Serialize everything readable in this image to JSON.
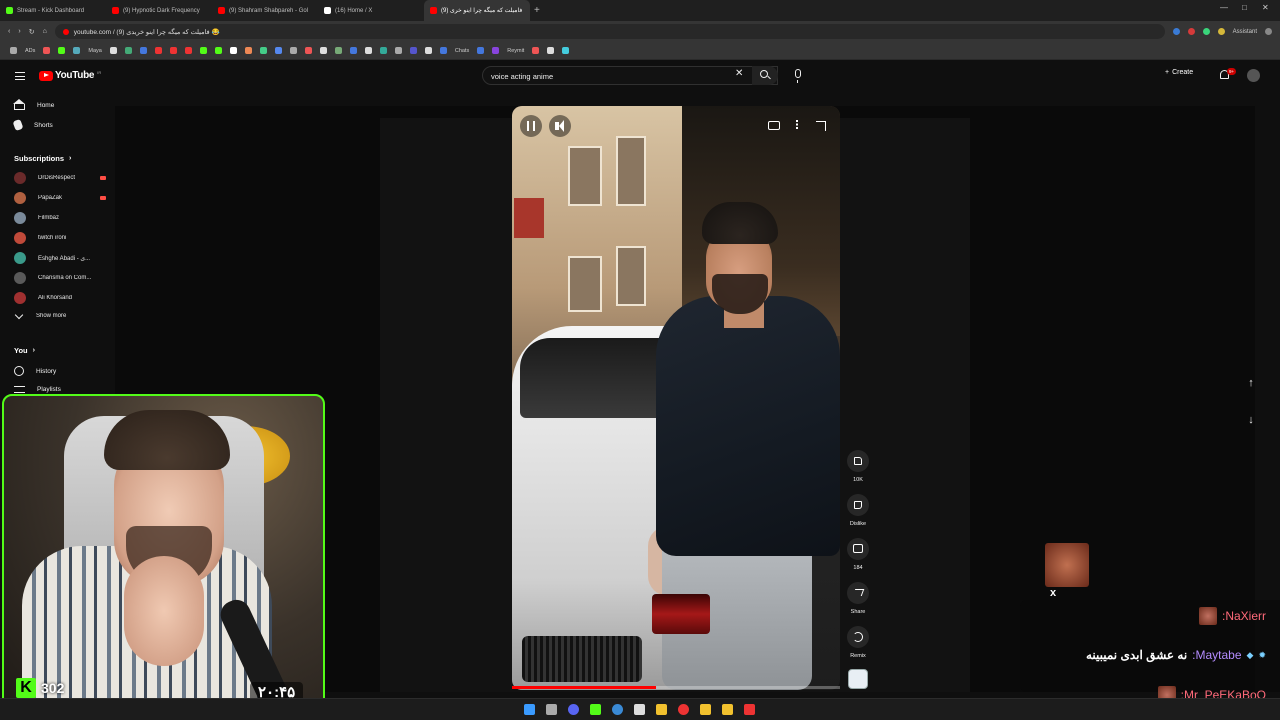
{
  "browser": {
    "tabs": [
      {
        "title": "Stream - Kick Dashboard",
        "favicon_color": "#53fc18",
        "active": false
      },
      {
        "title": "(9) Hypnotic Dark Frequency",
        "favicon_color": "#ff0000",
        "active": false
      },
      {
        "title": "(9) Shahram Shabpareh - Gol",
        "favicon_color": "#ff0000",
        "active": false
      },
      {
        "title": "(16) Home / X",
        "favicon_color": "#ffffff",
        "active": false
      },
      {
        "title": "(9) فامیلت که میگه چرا اینو خری",
        "favicon_color": "#ff0000",
        "active": true
      }
    ],
    "new_tab": "+",
    "address": "youtube.com / (9) فامیلت که میگه چرا اینو خریدی 😂",
    "assistant_label": "Assistant",
    "bookmarks": [
      "ADs",
      "Maya",
      "Chats",
      "Reymit"
    ]
  },
  "header": {
    "logo_text": "YouTube",
    "country_code": "IR",
    "search_value": "voice acting anime",
    "search_clear": "✕",
    "create_label": "Create",
    "notification_count": "9+"
  },
  "sidebar": {
    "home_label": "Home",
    "shorts_label": "Shorts",
    "subscriptions_title": "Subscriptions",
    "subscriptions": [
      {
        "name": "DrDisRespect",
        "color": "#6a2a2a",
        "live": true
      },
      {
        "name": "PapaZak",
        "color": "#b06040",
        "live": true
      },
      {
        "name": "Filmbaz",
        "color": "#7a8a9a",
        "live": false
      },
      {
        "name": "twitch ironi",
        "color": "#c04a3a",
        "live": false
      },
      {
        "name": "Eshghe Abadi - ی...",
        "color": "#3a9a8a",
        "live": false
      },
      {
        "name": "Charisma on Com...",
        "color": "#5a5a5a",
        "live": false
      },
      {
        "name": "Ali Khorsand",
        "color": "#a03030",
        "live": false
      }
    ],
    "show_more_label": "Show more",
    "you_title": "You",
    "history_label": "History",
    "playlists_label": "Playlists"
  },
  "short": {
    "progress": 0.44,
    "actions": [
      {
        "name": "like",
        "label": "10K"
      },
      {
        "name": "dislike",
        "label": "Dislike"
      },
      {
        "name": "comments",
        "label": "184"
      },
      {
        "name": "share",
        "label": "Share"
      },
      {
        "name": "remix",
        "label": "Remix"
      }
    ]
  },
  "stream_overlay": {
    "viewer_count": "302",
    "timer": "۲۰:۴۵",
    "kick_letter": "K",
    "brand_color": "#53fc18"
  },
  "chat": {
    "emote_multiplier": "x",
    "messages": [
      {
        "user": ":NaXierr",
        "text": "",
        "color": "pink"
      },
      {
        "user": ":Maytabe",
        "text": "نه عشق ابدی نمیبینه",
        "color": "purple"
      },
      {
        "user": ":Mr_PeEKaBoO",
        "text": "",
        "color": "pink"
      }
    ]
  }
}
